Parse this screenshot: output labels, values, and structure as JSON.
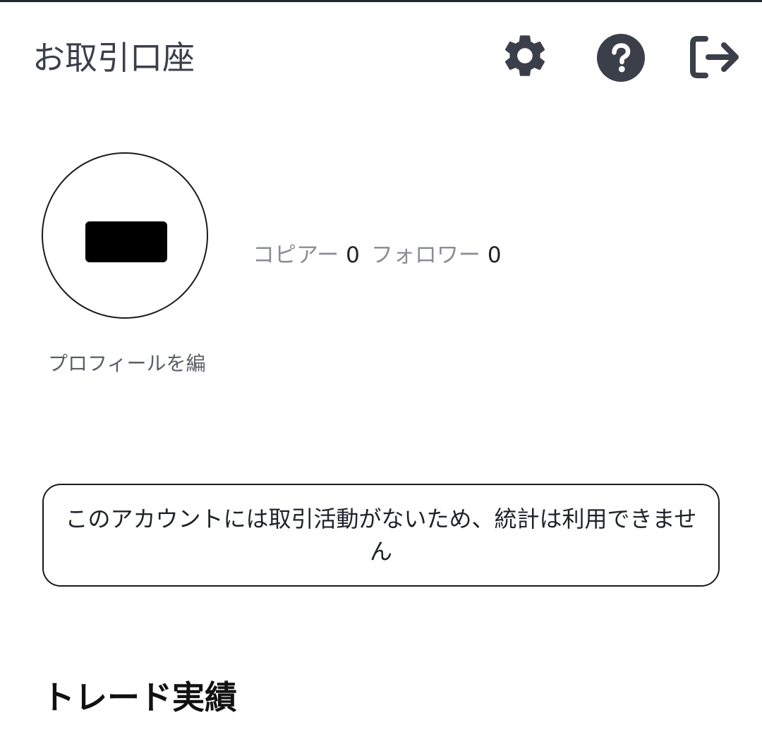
{
  "header": {
    "title": "お取引口座",
    "icons": {
      "settings": "gear-icon",
      "help": "question-circle-icon",
      "logout": "logout-icon"
    }
  },
  "profile": {
    "copier_label": "コピアー",
    "copier_count": "0",
    "follower_label": "フォロワー",
    "follower_count": "0",
    "edit_label": "プロフィールを編"
  },
  "notice": {
    "text": "このアカウントには取引活動がないため、統計は利用できません"
  },
  "section": {
    "title": "トレード実績"
  },
  "colors": {
    "icon": "#3b3f4a",
    "text_muted": "#8a8d93",
    "border": "#1a1a1a"
  }
}
